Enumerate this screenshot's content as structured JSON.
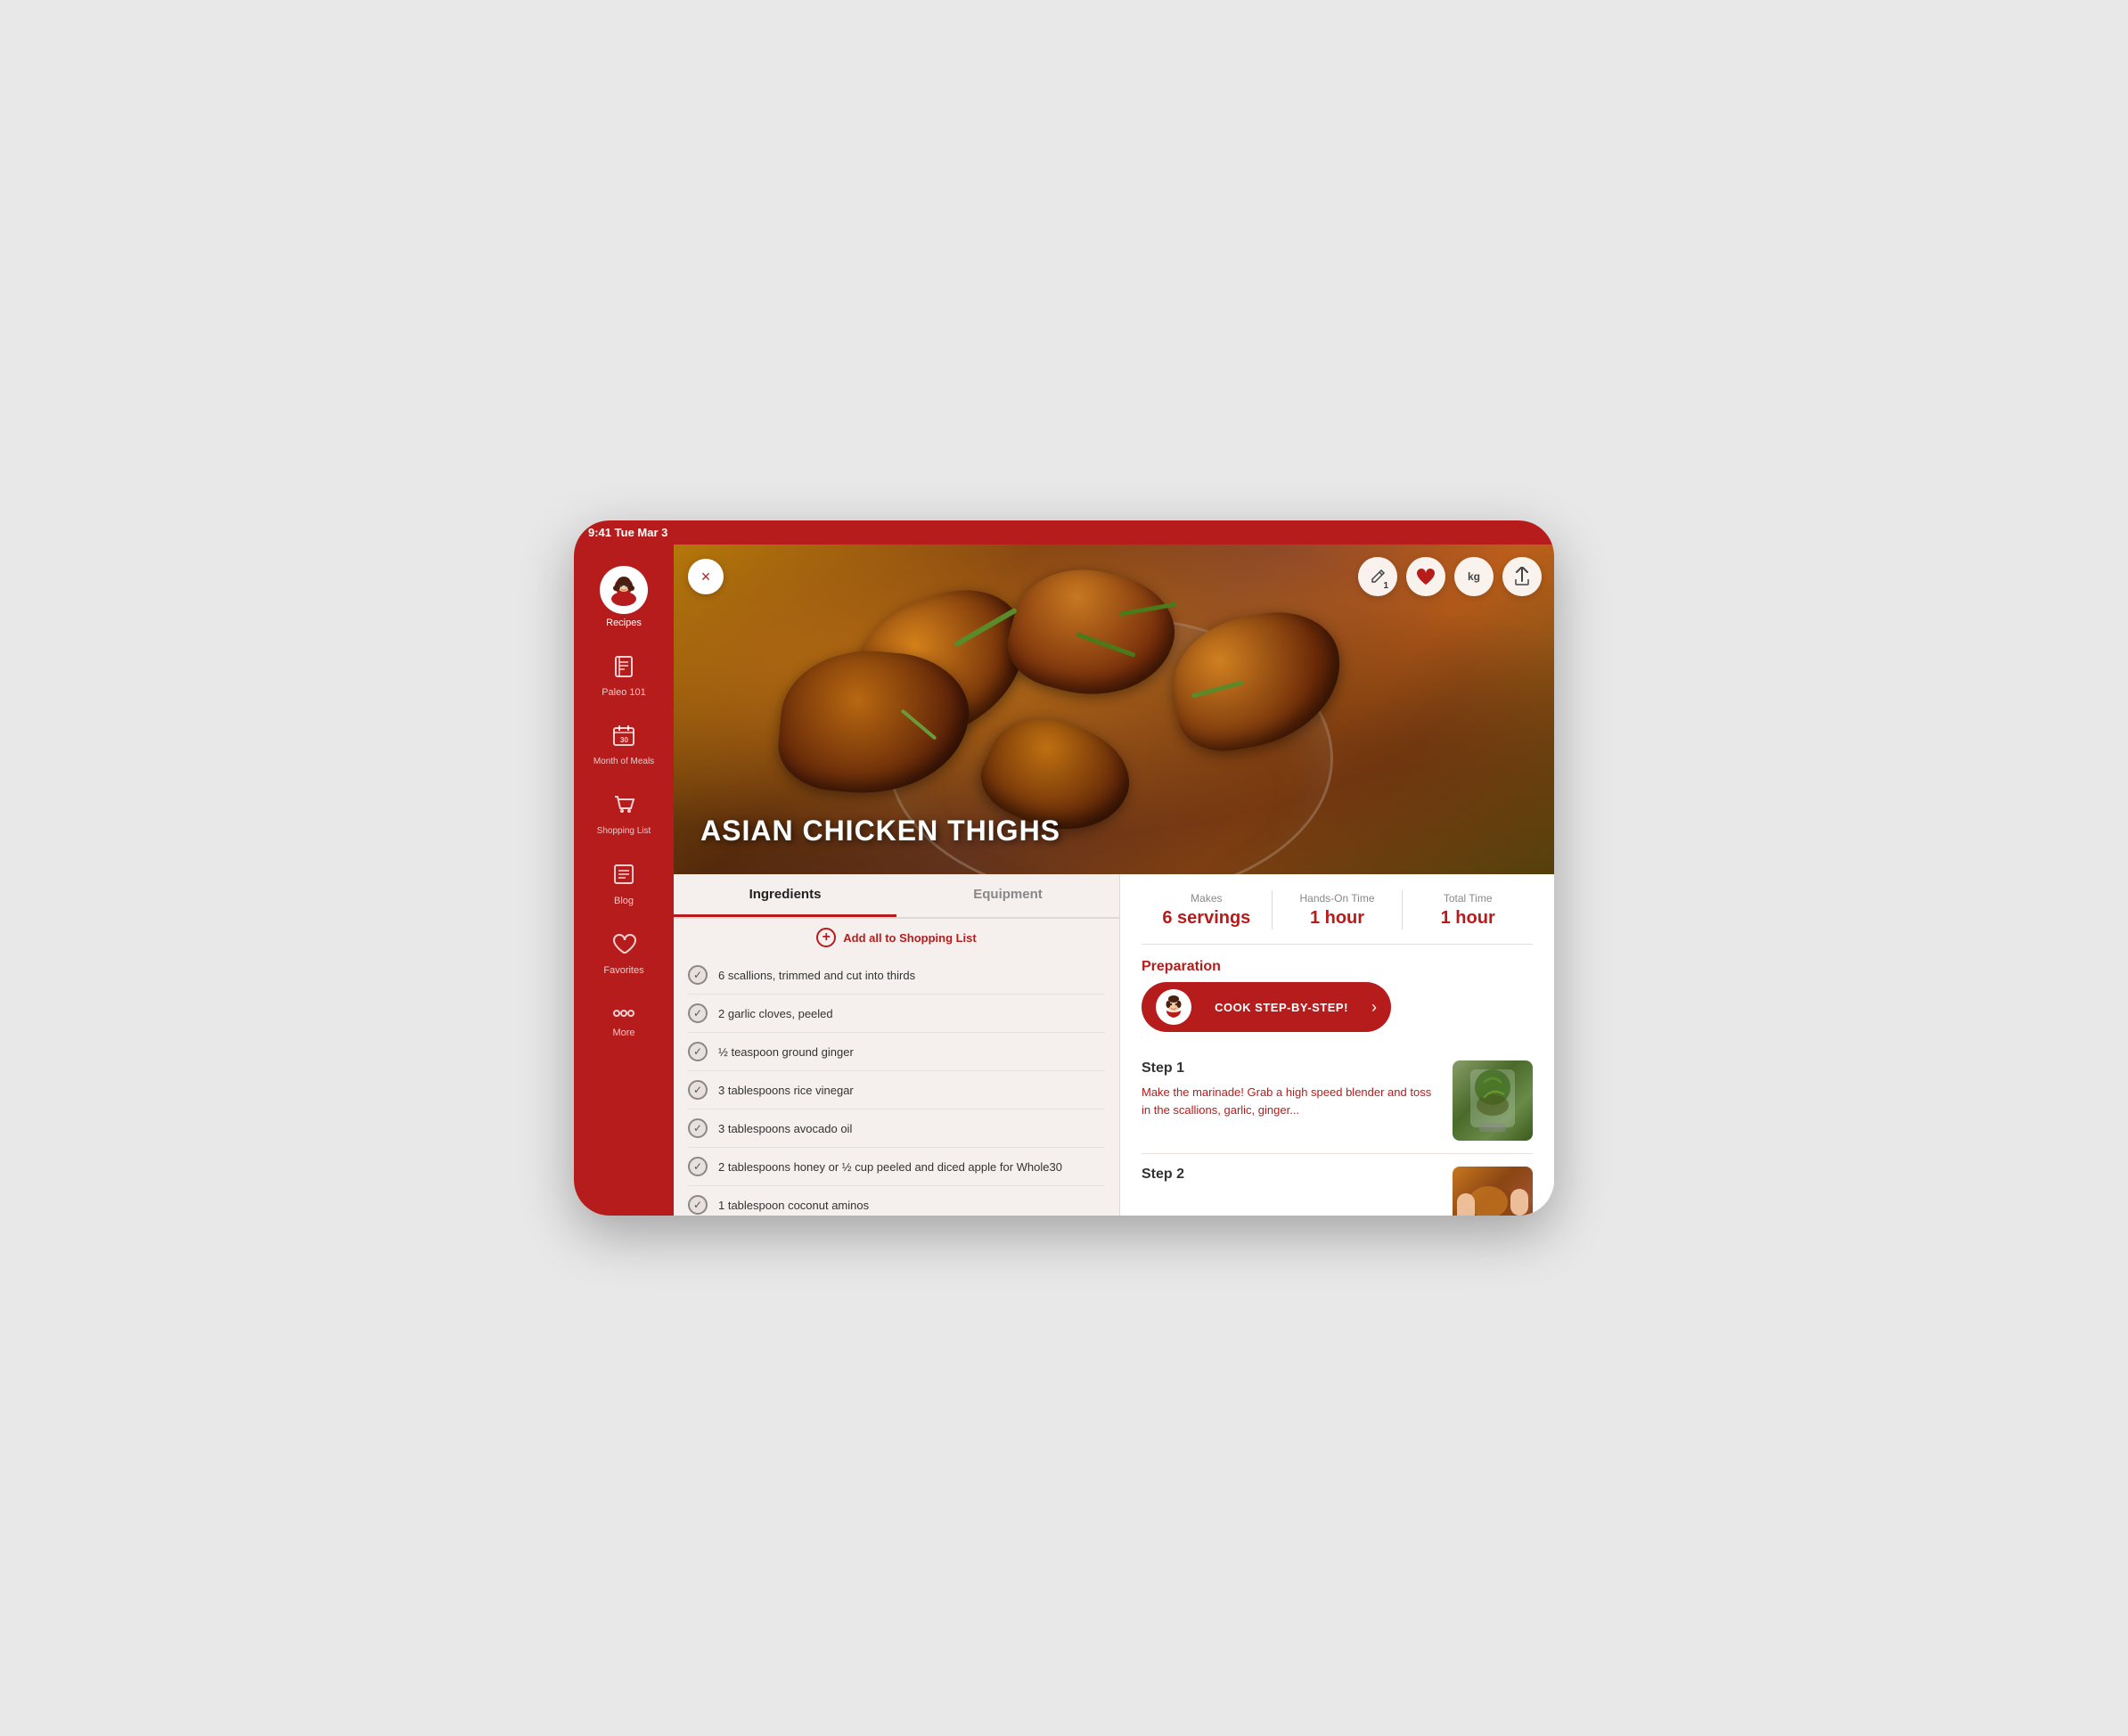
{
  "statusBar": {
    "time": "9:41",
    "date": "Tue Mar 3"
  },
  "sidebar": {
    "activeItem": "recipes",
    "items": [
      {
        "id": "recipes",
        "label": "Recipes",
        "icon": "avatar"
      },
      {
        "id": "paleo101",
        "label": "Paleo 101",
        "icon": "book"
      },
      {
        "id": "month-of-meals",
        "label": "Month of Meals",
        "icon": "calendar"
      },
      {
        "id": "shopping-list",
        "label": "Shopping List",
        "icon": "cart"
      },
      {
        "id": "blog",
        "label": "Blog",
        "icon": "blog"
      },
      {
        "id": "favorites",
        "label": "Favorites",
        "icon": "heart"
      },
      {
        "id": "more",
        "label": "More",
        "icon": "more"
      }
    ]
  },
  "hero": {
    "recipeTitle": "ASIAN CHICKEN THIGHS",
    "closeLabel": "×",
    "actions": {
      "editBadge": "1",
      "heartLabel": "♥",
      "kgLabel": "kg",
      "shareLabel": "↑"
    }
  },
  "tabs": {
    "items": [
      {
        "id": "ingredients",
        "label": "Ingredients",
        "active": true
      },
      {
        "id": "equipment",
        "label": "Equipment",
        "active": false
      }
    ]
  },
  "addAll": {
    "label": "Add all to Shopping List"
  },
  "ingredients": [
    {
      "text": "6 scallions, trimmed and cut into thirds",
      "checked": true
    },
    {
      "text": "2 garlic cloves, peeled",
      "checked": true
    },
    {
      "text": "½ teaspoon ground ginger",
      "checked": true
    },
    {
      "text": "3 tablespoons rice vinegar",
      "checked": true
    },
    {
      "text": "3 tablespoons avocado oil",
      "checked": true
    },
    {
      "text": "2 tablespoons honey or ½ cup peeled and diced apple for Whole30",
      "checked": true
    },
    {
      "text": "1 tablespoon coconut aminos",
      "checked": true
    }
  ],
  "stats": {
    "makes": {
      "label": "Makes",
      "value": "6 servings"
    },
    "handsOnTime": {
      "label": "Hands-On Time",
      "value": "1 hour"
    },
    "totalTime": {
      "label": "Total Time",
      "value": "1 hour"
    }
  },
  "preparation": {
    "label": "Preparation",
    "cookStepLabel": "Cook Step-by-Step!"
  },
  "steps": [
    {
      "id": "step1",
      "title": "Step 1",
      "text": "Make the marinade! Grab a high speed blender and toss in the scallions, garlic, ginger..."
    },
    {
      "id": "step2",
      "title": "Step 2",
      "text": ""
    }
  ]
}
